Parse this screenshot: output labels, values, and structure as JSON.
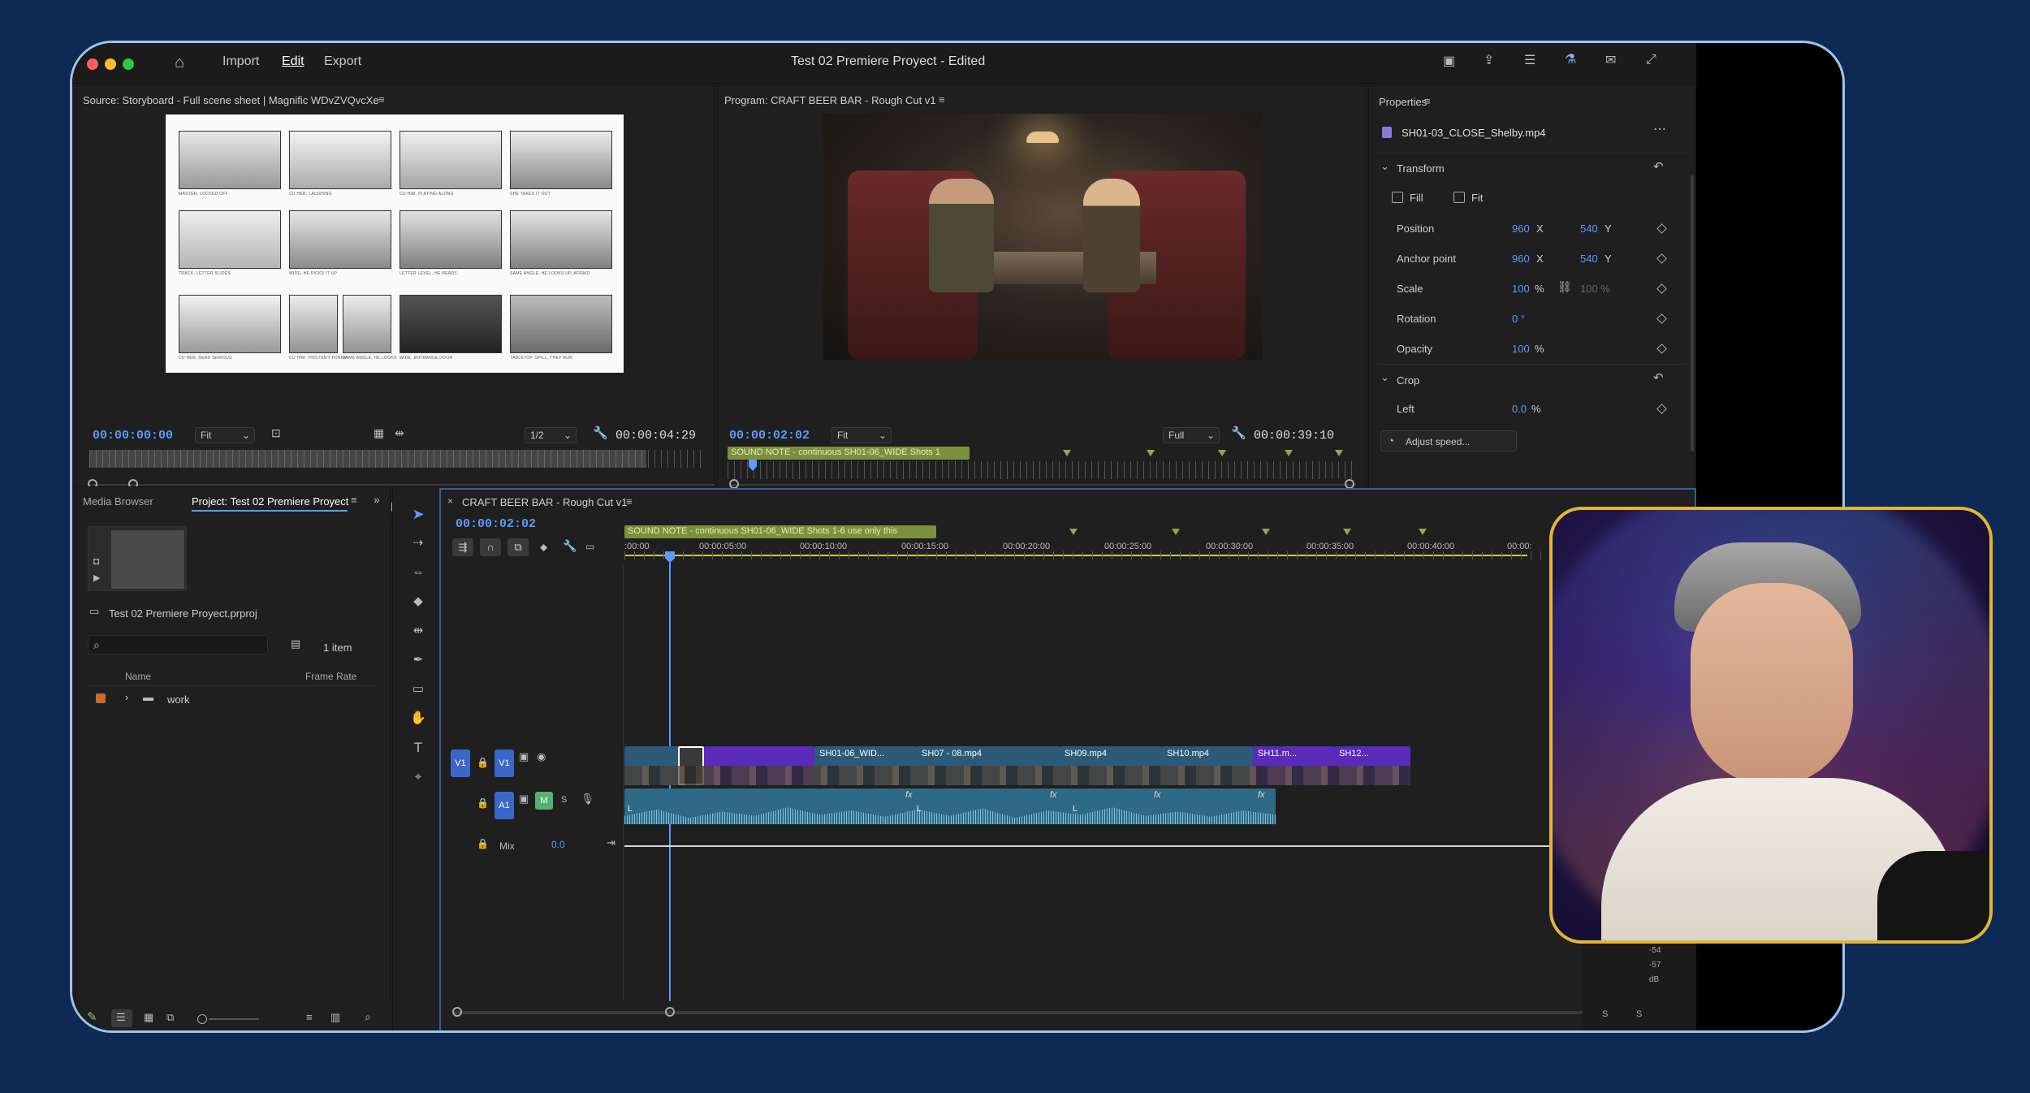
{
  "app": {
    "menu": {
      "import": "Import",
      "edit": "Edit",
      "export": "Export"
    },
    "title": "Test 02 Premiere Proyect - Edited"
  },
  "source": {
    "title": "Source: Storyboard - Full scene sheet | Magnific WDvZVQvcXe",
    "timecode": "00:00:00:00",
    "zoom": "Fit",
    "resolution": "1/2",
    "duration": "00:00:04:29",
    "captions": [
      "MASTER, LOCKED OFF",
      "CU HER, LAUGHING",
      "CU HIM, PLAYING ALONG",
      "SHE TAKES IT OUT",
      "TRACK, LETTER SLIDES",
      "WIDE, HE PICKS IT UP",
      "LETTER LEVEL, HE READS",
      "SAME ANGLE, HE LOOKS UP, AFRAID",
      "CU HER, DEAD SERIOUS",
      "CU HIM, THIS ISN'T FUNNY",
      "SAME ANGLE, HE LOOKS",
      "WIDE, ENTRANCE DOOR",
      "TABLETOP, SPILL, THEY RUN"
    ]
  },
  "program": {
    "title": "Program: CRAFT BEER BAR - Rough Cut v1",
    "timecode": "00:00:02:02",
    "zoom": "Fit",
    "resolution": "Full",
    "duration": "00:00:39:10",
    "marker_label": "SOUND NOTE - continuous SH01-06_WIDE Shots 1"
  },
  "properties": {
    "title": "Properties",
    "clip": "SH01-03_CLOSE_Shelby.mp4",
    "transform": "Transform",
    "fill": "Fill",
    "fit": "Fit",
    "position": {
      "label": "Position",
      "x": "960",
      "x_unit": "X",
      "y": "540",
      "y_unit": "Y"
    },
    "anchor": {
      "label": "Anchor point",
      "x": "960",
      "x_unit": "X",
      "y": "540",
      "y_unit": "Y"
    },
    "scale": {
      "label": "Scale",
      "value": "100",
      "unit": "%",
      "value2": "100 %"
    },
    "rotation": {
      "label": "Rotation",
      "value": "0 °"
    },
    "opacity": {
      "label": "Opacity",
      "value": "100",
      "unit": "%"
    },
    "crop": "Crop",
    "left": {
      "label": "Left",
      "value": "0.0",
      "unit": "%"
    },
    "adjust_speed": "Adjust speed..."
  },
  "project": {
    "tab_media": "Media Browser",
    "tab_project": "Project: Test 02 Premiere Proyect",
    "file": "Test 02 Premiere Proyect.prproj",
    "count": "1 item",
    "col_name": "Name",
    "col_rate": "Frame Rate",
    "folder": "work"
  },
  "timeline": {
    "title": "CRAFT BEER BAR - Rough Cut v1",
    "timecode": "00:00:02:02",
    "marker_label": "SOUND NOTE - continuous SH01-06_WIDE Shots 1-6 use only this",
    "ticks": [
      ":00:00",
      "00:00:05:00",
      "00:00:10:00",
      "00:00:15:00",
      "00:00:20:00",
      "00:00:25:00",
      "00:00:30:00",
      "00:00:35:00",
      "00:00:40:00",
      "00:00:"
    ],
    "v1": "V1",
    "a1": "A1",
    "m": "M",
    "s": "S",
    "mix": "Mix",
    "mix_val": "0.0",
    "clips": [
      "SH01-06_WID...",
      "SH07 - 08.mp4",
      "SH09.mp4",
      "SH10.mp4",
      "SH11.m...",
      "SH12..."
    ],
    "fx": "fx",
    "l": "L"
  },
  "meter": {
    "labels": [
      "-54",
      "-57",
      "dB"
    ],
    "s1": "S",
    "s2": "S"
  }
}
